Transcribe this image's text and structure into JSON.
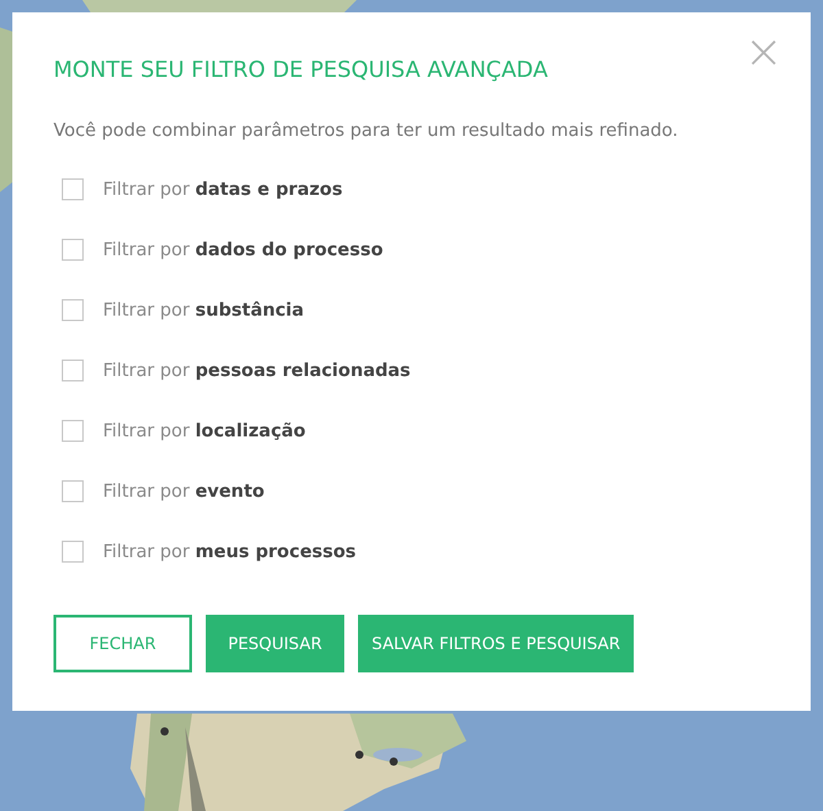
{
  "dialog": {
    "title": "MONTE SEU FILTRO DE PESQUISA AVANÇADA",
    "close": "×",
    "description": "Você pode combinar parâmetros para ter um resultado mais refinado.",
    "filters": [
      {
        "label": "Filtrar por **datas e prazos**",
        "checked": false
      },
      {
        "label": "Filtrar por **dados do processo**",
        "checked": false
      },
      {
        "label": "Filtrar por **substância**",
        "checked": false
      },
      {
        "label": "Filtrar por **pessoas relacionadas**",
        "checked": false
      },
      {
        "label": "Filtrar por **localização**",
        "checked": false
      },
      {
        "label": "Filtrar por **evento**",
        "checked": false
      },
      {
        "label": "Filtrar por **meus processos**",
        "checked": false
      }
    ],
    "buttons": [
      {
        "label": "FECHAR",
        "kind": "outline"
      },
      {
        "label": "PESQUISAR",
        "kind": "primary"
      },
      {
        "label": "SALVAR FILTROS E PESQUISAR",
        "kind": "primary"
      }
    ]
  }
}
